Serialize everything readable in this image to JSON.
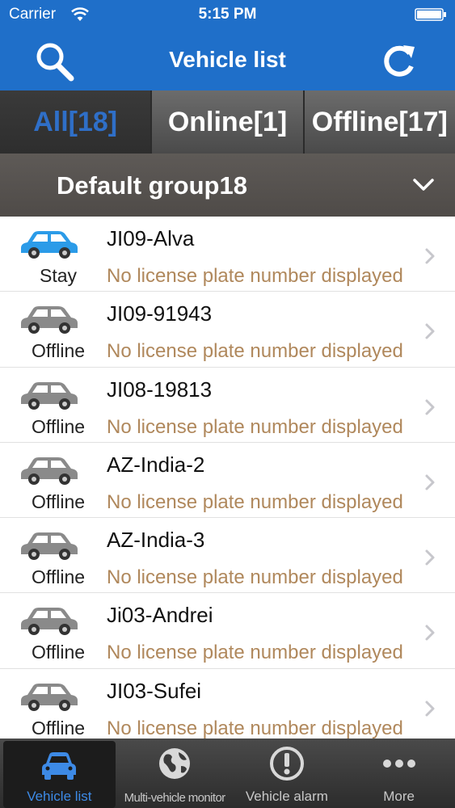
{
  "status_bar": {
    "carrier": "Carrier",
    "time": "5:15 PM"
  },
  "nav": {
    "title": "Vehicle list",
    "left_icon": "search-icon",
    "right_icon": "refresh-icon"
  },
  "tabs": [
    {
      "label": "All[18]",
      "active": true
    },
    {
      "label": "Online[1]",
      "active": false
    },
    {
      "label": "Offline[17]",
      "active": false
    }
  ],
  "group": {
    "label": "Default group18",
    "icon": "chevron-down-icon"
  },
  "vehicles": [
    {
      "name": "JI09-Alva",
      "status": "Stay",
      "plate": "No license plate number displayed",
      "car_color": "#2b9be8"
    },
    {
      "name": "JI09-91943",
      "status": "Offline",
      "plate": "No license plate number displayed",
      "car_color": "#8a8a8a"
    },
    {
      "name": "JI08-19813",
      "status": "Offline",
      "plate": "No license plate number displayed",
      "car_color": "#8a8a8a"
    },
    {
      "name": "AZ-India-2",
      "status": "Offline",
      "plate": "No license plate number displayed",
      "car_color": "#8a8a8a"
    },
    {
      "name": "AZ-India-3",
      "status": "Offline",
      "plate": "No license plate number displayed",
      "car_color": "#8a8a8a"
    },
    {
      "name": "Ji03-Andrei",
      "status": "Offline",
      "plate": "No license plate number displayed",
      "car_color": "#8a8a8a"
    },
    {
      "name": "JI03-Sufei",
      "status": "Offline",
      "plate": "No license plate number displayed",
      "car_color": "#8a8a8a"
    }
  ],
  "tabbar": [
    {
      "label": "Vehicle list",
      "icon": "car-icon",
      "active": true
    },
    {
      "label": "Multi-vehicle monitor",
      "icon": "globe-icon",
      "active": false
    },
    {
      "label": "Vehicle alarm",
      "icon": "alert-icon",
      "active": false
    },
    {
      "label": "More",
      "icon": "more-dots-icon",
      "active": false
    }
  ],
  "colors": {
    "nav_blue": "#1f6fc9",
    "active_tab_text": "#2f6fc8",
    "plate_text": "#b0885c",
    "tabbar_active": "#3d8ae6"
  }
}
